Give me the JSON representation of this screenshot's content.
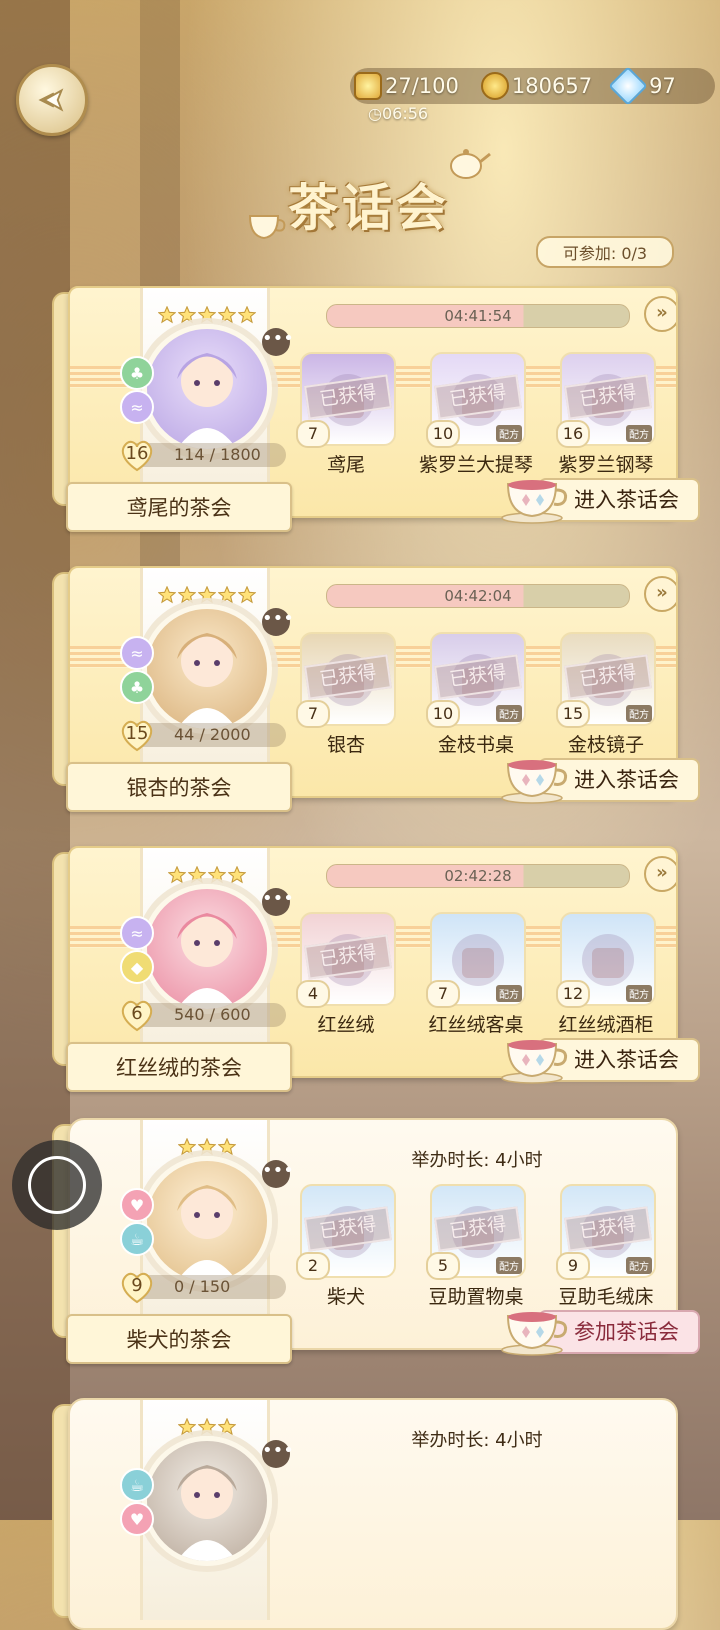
{
  "hud": {
    "stamina": "27/100",
    "gold": "180657",
    "diamonds": "97",
    "timer": "06:56"
  },
  "title": "茶话会",
  "join_count": "可参加:   0/3",
  "stamp_text": "已获得",
  "recipe_tag": "配方",
  "parties": [
    {
      "stars": 5,
      "countdown": "04:41:54",
      "level": "16",
      "progress": "114 / 1800",
      "name": "鸢尾的茶会",
      "button": "进入茶话会",
      "items": [
        {
          "num": "7",
          "label": "鸢尾",
          "obtained": true,
          "recipe": false
        },
        {
          "num": "10",
          "label": "紫罗兰大提琴",
          "obtained": true,
          "recipe": true
        },
        {
          "num": "16",
          "label": "紫罗兰钢琴",
          "obtained": true,
          "recipe": true
        }
      ]
    },
    {
      "stars": 5,
      "countdown": "04:42:04",
      "level": "15",
      "progress": "44 / 2000",
      "name": "银杏的茶会",
      "button": "进入茶话会",
      "items": [
        {
          "num": "7",
          "label": "银杏",
          "obtained": true,
          "recipe": false
        },
        {
          "num": "10",
          "label": "金枝书桌",
          "obtained": true,
          "recipe": true
        },
        {
          "num": "15",
          "label": "金枝镜子",
          "obtained": true,
          "recipe": true
        }
      ]
    },
    {
      "stars": 4,
      "countdown": "02:42:28",
      "level": "6",
      "progress": "540 / 600",
      "name": "红丝绒的茶会",
      "button": "进入茶话会",
      "items": [
        {
          "num": "4",
          "label": "红丝绒",
          "obtained": true,
          "recipe": false
        },
        {
          "num": "7",
          "label": "红丝绒客桌",
          "obtained": false,
          "recipe": true
        },
        {
          "num": "12",
          "label": "红丝绒酒柜",
          "obtained": false,
          "recipe": true
        }
      ]
    },
    {
      "stars": 3,
      "duration": "举办时长:  4小时",
      "level": "9",
      "progress": "0 / 150",
      "name": "柴犬的茶会",
      "button": "参加茶话会",
      "items": [
        {
          "num": "2",
          "label": "柴犬",
          "obtained": true,
          "recipe": false
        },
        {
          "num": "5",
          "label": "豆助置物桌",
          "obtained": true,
          "recipe": true
        },
        {
          "num": "9",
          "label": "豆助毛绒床",
          "obtained": true,
          "recipe": true
        }
      ]
    },
    {
      "stars": 3,
      "duration": "举办时长:  4小时"
    }
  ],
  "colors": {
    "accent_gold": "#e5cc89",
    "panel": "#fff4cf",
    "countdown_pink": "#f6c9c0"
  }
}
